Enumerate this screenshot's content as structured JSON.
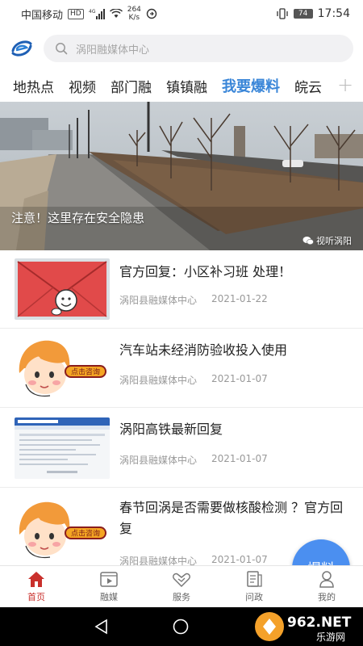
{
  "status_bar": {
    "carrier": "中国移动",
    "hd": "HD",
    "network": "4G",
    "speed_value": "264",
    "speed_unit": "K/s",
    "battery": "74",
    "time": "17:54"
  },
  "search": {
    "placeholder": "涡阳融媒体中心"
  },
  "tabs": [
    {
      "label": "地热点"
    },
    {
      "label": "视频"
    },
    {
      "label": "部门融"
    },
    {
      "label": "镇镇融"
    },
    {
      "label": "我要爆料",
      "active": true
    },
    {
      "label": "皖云"
    }
  ],
  "banner": {
    "caption": "注意！这里存在安全隐患",
    "source": "视听涡阳"
  },
  "news": [
    {
      "title": "官方回复：小区补习班 处理！",
      "source": "涡阳县融媒体中心",
      "date": "2021-01-22",
      "thumb": "envelope"
    },
    {
      "title": "汽车站未经消防验收投入使用",
      "source": "涡阳县融媒体中心",
      "date": "2021-01-07",
      "thumb": "consult",
      "thumb_label": "点击咨询"
    },
    {
      "title": "涡阳高铁最新回复",
      "source": "涡阳县融媒体中心",
      "date": "2021-01-07",
      "thumb": "webpage"
    },
    {
      "title": "春节回涡是否需要做核酸检测 ？官方回复",
      "source": "涡阳县融媒体中心",
      "date": "2021-01-07",
      "thumb": "consult",
      "thumb_label": "点击咨询"
    }
  ],
  "fab": {
    "label": "爆料"
  },
  "bottom_nav": [
    {
      "label": "首页",
      "icon": "home-icon",
      "active": true
    },
    {
      "label": "融媒",
      "icon": "video-icon"
    },
    {
      "label": "服务",
      "icon": "handshake-icon"
    },
    {
      "label": "问政",
      "icon": "document-icon"
    },
    {
      "label": "我的",
      "icon": "user-icon"
    }
  ],
  "watermark": {
    "brand": "962.NET",
    "sub": "乐游网"
  },
  "colors": {
    "accent": "#3a86d8",
    "active_nav": "#c9302c",
    "fab": "#4b8ff0"
  }
}
